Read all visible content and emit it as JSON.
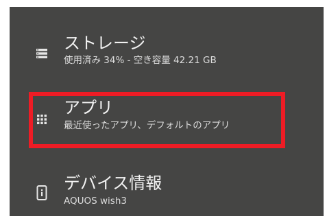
{
  "settings": {
    "items": [
      {
        "title": "ストレージ",
        "subtitle": "使用済み 34% - 空き容量 42.21 GB",
        "icon": "storage-icon"
      },
      {
        "title": "アプリ",
        "subtitle": "最近使ったアプリ、デフォルトのアプリ",
        "icon": "apps-grid-icon"
      },
      {
        "title": "デバイス情報",
        "subtitle": "AQUOS wish3",
        "icon": "device-info-icon"
      }
    ]
  },
  "colors": {
    "background": "#454544",
    "text_primary": "#f2f2f2",
    "text_secondary": "#dcdcdc",
    "highlight": "#ee1c25"
  }
}
